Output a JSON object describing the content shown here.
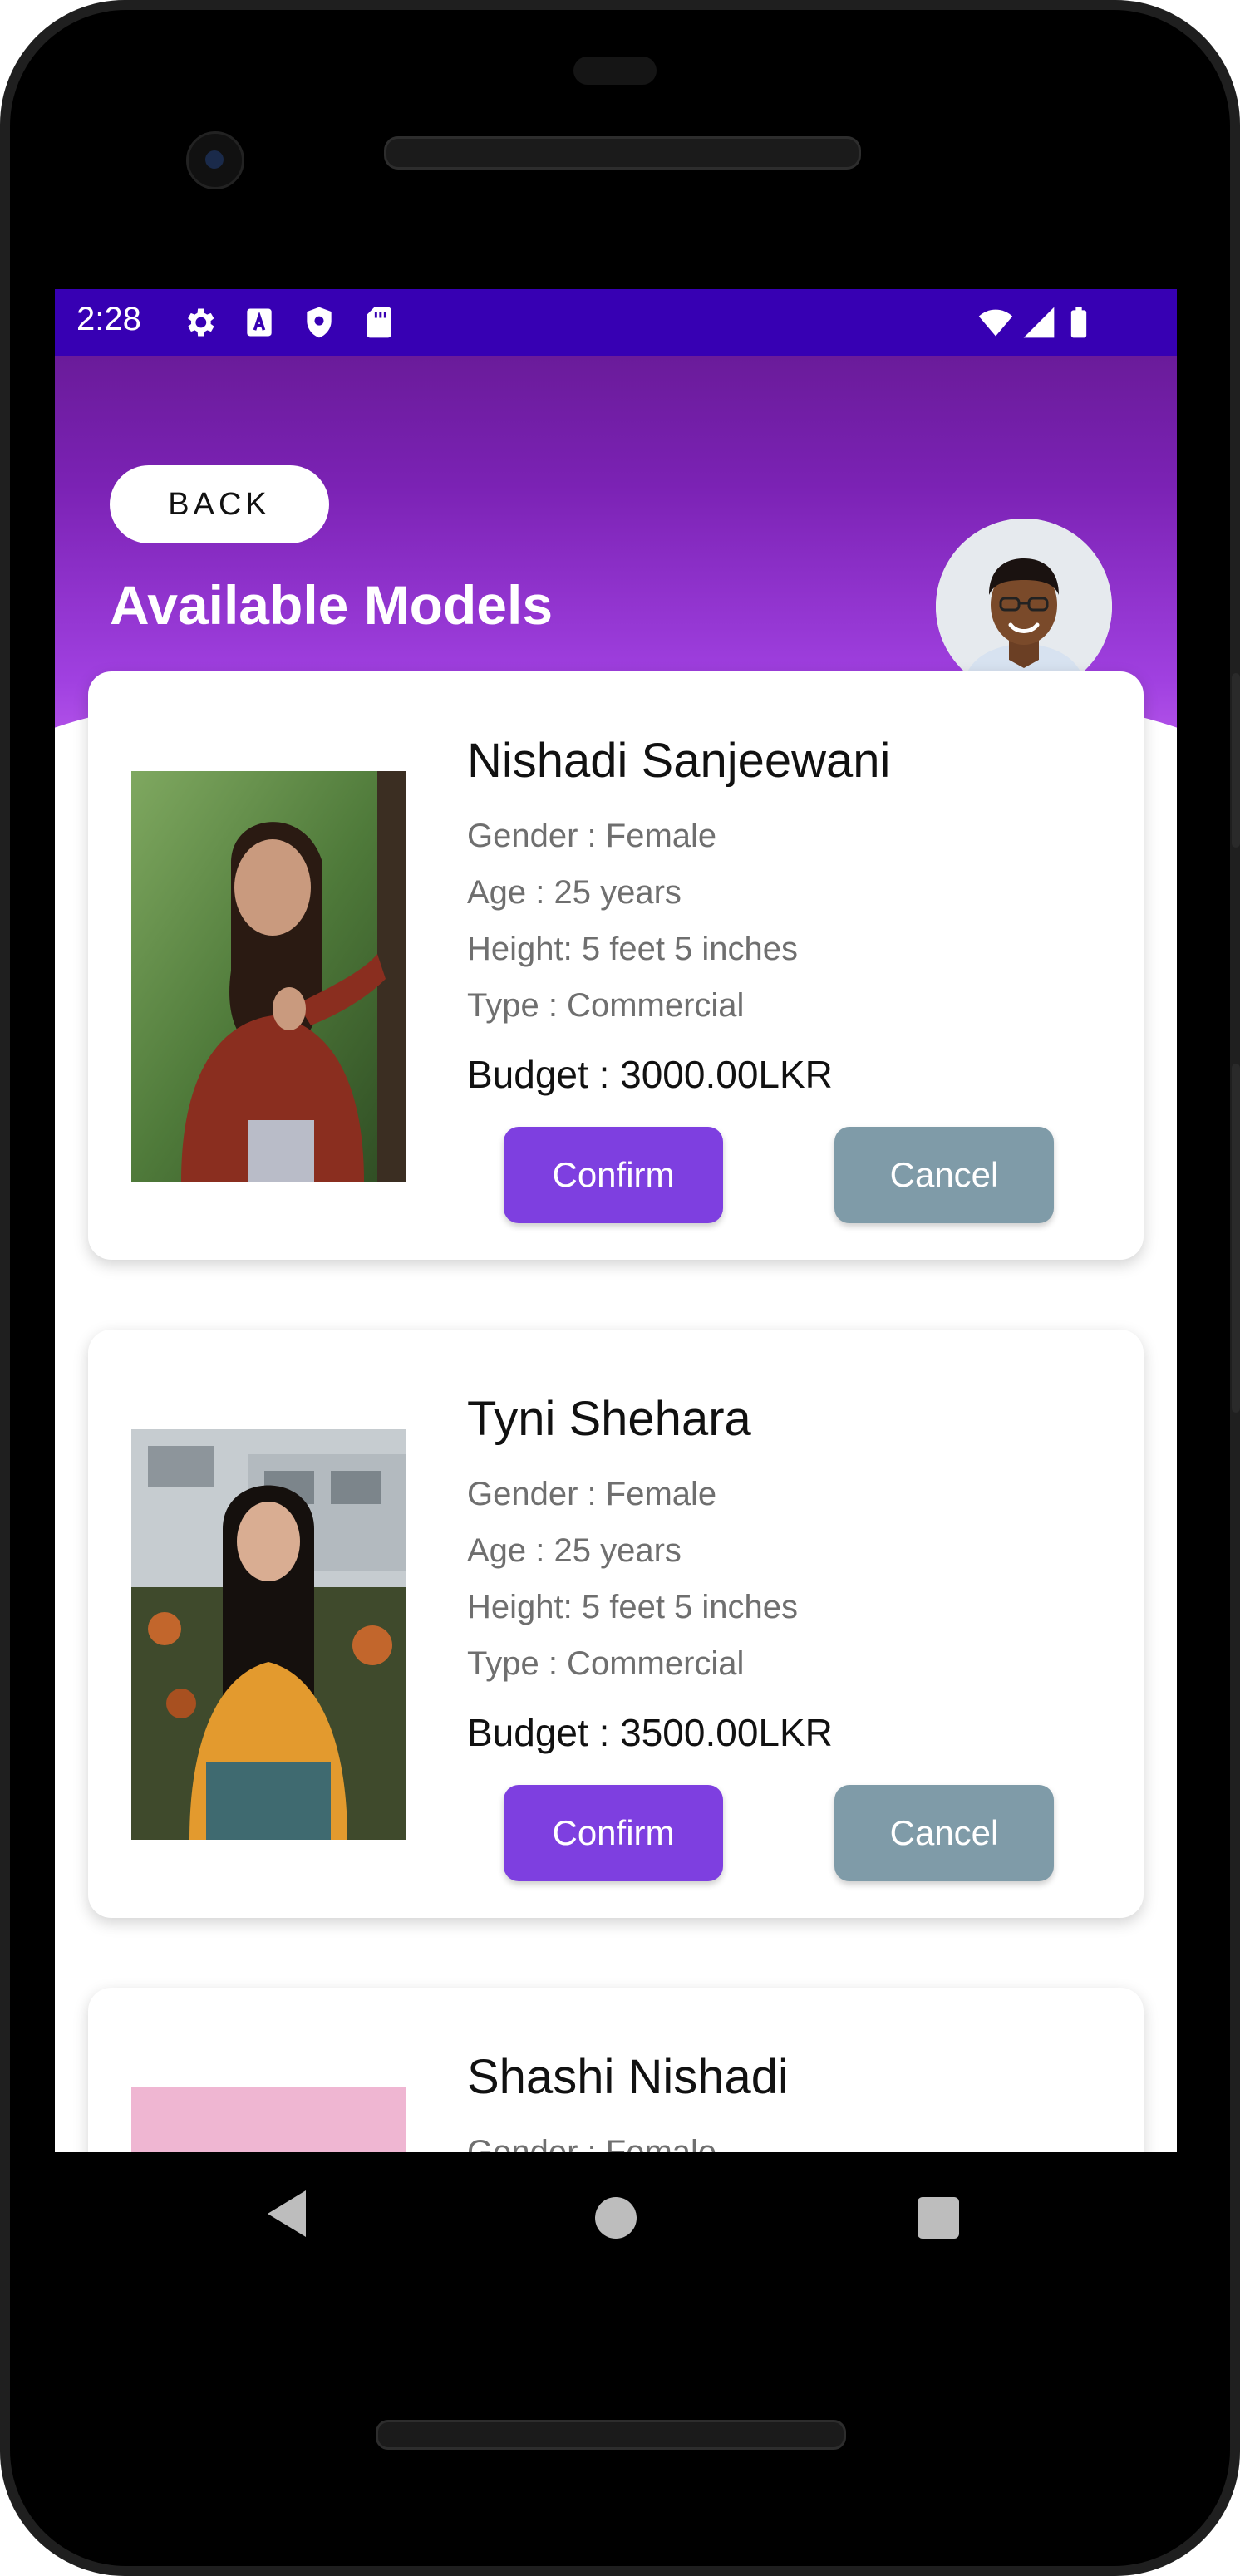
{
  "status_bar": {
    "time": "2:28",
    "icons": [
      "settings-icon",
      "sim-a-icon",
      "shield-icon",
      "sd-card-icon",
      "wifi-icon",
      "signal-icon",
      "battery-icon"
    ]
  },
  "header": {
    "back_label": "BACK",
    "title": "Available Models"
  },
  "colors": {
    "status_bar": "#3700b3",
    "header_top": "#6a1b9a",
    "header_bottom": "#c061f0",
    "confirm": "#7e3fe0",
    "cancel": "#7f9ba8"
  },
  "models": [
    {
      "name": "Nishadi Sanjeewani",
      "gender": "Gender : Female",
      "age": "Age : 25 years",
      "height": "Height: 5 feet 5 inches",
      "type": "Type : Commercial",
      "budget": "Budget : 3000.00LKR",
      "confirm_label": "Confirm",
      "cancel_label": "Cancel"
    },
    {
      "name": "Tyni Shehara",
      "gender": "Gender : Female",
      "age": "Age : 25 years",
      "height": "Height: 5 feet 5 inches",
      "type": "Type : Commercial",
      "budget": "Budget : 3500.00LKR",
      "confirm_label": "Confirm",
      "cancel_label": "Cancel"
    },
    {
      "name": "Shashi Nishadi",
      "gender": "Gender : Female"
    }
  ],
  "nav": {
    "icons": [
      "back-nav-icon",
      "home-nav-icon",
      "recents-nav-icon"
    ]
  }
}
